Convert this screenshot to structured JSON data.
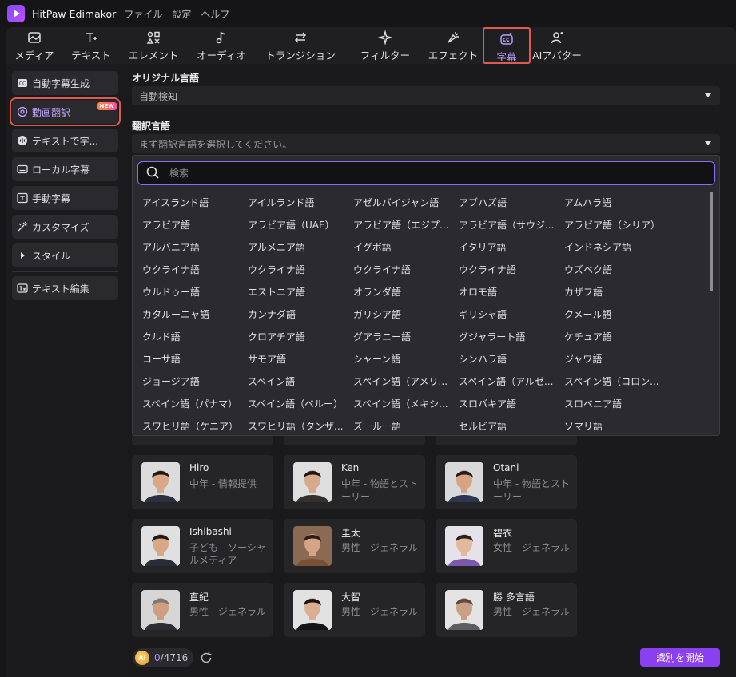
{
  "app": {
    "title": "HitPaw Edimakor"
  },
  "menu": [
    "ファイル",
    "設定",
    "ヘルプ"
  ],
  "toolbar": [
    {
      "label": "メディア",
      "icon": "media-icon"
    },
    {
      "label": "テキスト",
      "icon": "text-icon"
    },
    {
      "label": "エレメント",
      "icon": "element-icon"
    },
    {
      "label": "オーディオ",
      "icon": "audio-icon"
    },
    {
      "label": "トランジション",
      "icon": "transition-icon"
    },
    {
      "label": "フィルター",
      "icon": "filter-icon"
    },
    {
      "label": "エフェクト",
      "icon": "effect-icon"
    },
    {
      "label": "字幕",
      "icon": "subtitle-icon",
      "active": true
    },
    {
      "label": "AIアバター",
      "icon": "ai-avatar-icon"
    }
  ],
  "sidebar": {
    "items": [
      {
        "label": "自動字幕生成",
        "icon": "cc-icon"
      },
      {
        "label": "動画翻訳",
        "icon": "translate-icon",
        "active": true,
        "badge": "NEW"
      },
      {
        "label": "テキストで字...",
        "icon": "voice-icon"
      },
      {
        "label": "ローカル字幕",
        "icon": "local-subtitle-icon"
      },
      {
        "label": "手動字幕",
        "icon": "manual-subtitle-icon"
      },
      {
        "label": "カスタマイズ",
        "icon": "customize-icon"
      },
      {
        "label": "スタイル",
        "icon": "triangle-right-icon"
      },
      {
        "label": "テキスト編集",
        "icon": "text-edit-icon"
      }
    ]
  },
  "original_language": {
    "label": "オリジナル言語",
    "value": "自動検知"
  },
  "target_language": {
    "label": "翻訳言語",
    "placeholder": "まず翻訳言語を選択してください。",
    "search_placeholder": "検索",
    "options": [
      [
        "アイスランド語",
        "アイルランド語",
        "アゼルバイジャン語",
        "アブハズ語",
        "アムハラ語"
      ],
      [
        "アラビア語",
        "アラビア語（UAE）",
        "アラビア語（エジプ...",
        "アラビア語（サウジ...",
        "アラビア語（シリア）"
      ],
      [
        "アルバニア語",
        "アルメニア語",
        "イグボ語",
        "イタリア語",
        "インドネシア語"
      ],
      [
        "ウクライナ語",
        "ウクライナ語",
        "ウクライナ語",
        "ウクライナ語",
        "ウズベク語"
      ],
      [
        "ウルドゥー語",
        "エストニア語",
        "オランダ語",
        "オロモ語",
        "カザフ語"
      ],
      [
        "カタルーニャ語",
        "カンナダ語",
        "ガリシア語",
        "ギリシャ語",
        "クメール語"
      ],
      [
        "クルド語",
        "クロアチア語",
        "グアラニー語",
        "グジャラート語",
        "ケチュア語"
      ],
      [
        "コーサ語",
        "サモア語",
        "シャーン語",
        "シンハラ語",
        "ジャワ語"
      ],
      [
        "ジョージア語",
        "スペイン語",
        "スペイン語（アメリ...",
        "スペイン語（アルゼ...",
        "スペイン語（コロン..."
      ],
      [
        "スペイン語（パナマ）",
        "スペイン語（ペルー）",
        "スペイン語（メキシ...",
        "スロバキア語",
        "スロベニア語"
      ],
      [
        "スワヒリ語（ケニア）",
        "スワヒリ語（タンザ...",
        "ズールー語",
        "セルビア語",
        "ソマリ語"
      ]
    ]
  },
  "voices": [
    {
      "name": "Hiro",
      "desc": "中年 - 情報提供",
      "skin": "#d9a886",
      "hair": "#1f1a17",
      "shirt": "#2a3040",
      "bg": "#dcdcdc"
    },
    {
      "name": "Ken",
      "desc": "中年 - 物語とストーリー",
      "skin": "#d8a98a",
      "hair": "#1c1815",
      "shirt": "#33302e",
      "bg": "#dedede"
    },
    {
      "name": "Otani",
      "desc": "中年 - 物語とストーリー",
      "skin": "#d6a483",
      "hair": "#231c18",
      "shirt": "#2d3550",
      "bg": "#d9d9d9"
    },
    {
      "name": "Ishibashi",
      "desc": "子ども - ソーシャルメディア",
      "skin": "#d7a888",
      "hair": "#1d1916",
      "shirt": "#2a2d38",
      "bg": "#e0e0e0"
    },
    {
      "name": "圭太",
      "desc": "男性 - ジェネラル",
      "skin": "#d5a487",
      "hair": "#241d19",
      "shirt": "#7a5034",
      "bg": "#8a6a52"
    },
    {
      "name": "碧衣",
      "desc": "女性 - ジェネラル",
      "skin": "#e3b99d",
      "hair": "#2a1f1a",
      "shirt": "#7c5aa8",
      "bg": "#e6e2ea"
    },
    {
      "name": "直紀",
      "desc": "男性 - ジェネラル",
      "skin": "#cf9d80",
      "hair": "#7a7774",
      "shirt": "#2d2d33",
      "bg": "#d6d6d6"
    },
    {
      "name": "大智",
      "desc": "男性 - ジェネラル",
      "skin": "#dcae90",
      "hair": "#171412",
      "shirt": "#151518",
      "bg": "#e2e2e2"
    },
    {
      "name": "勝 多言語",
      "desc": "男性 - ジェネラル",
      "skin": "#caa085",
      "hair": "#5a4a3d",
      "shirt": "#5b5d62",
      "bg": "#e4e4e4"
    }
  ],
  "footer": {
    "credits_used": "0",
    "credits_total": "/4716",
    "start_label": "識別を開始"
  },
  "colors": {
    "accent": "#8a3ff0",
    "highlight": "#e05a50",
    "active_text": "#b99bff"
  }
}
